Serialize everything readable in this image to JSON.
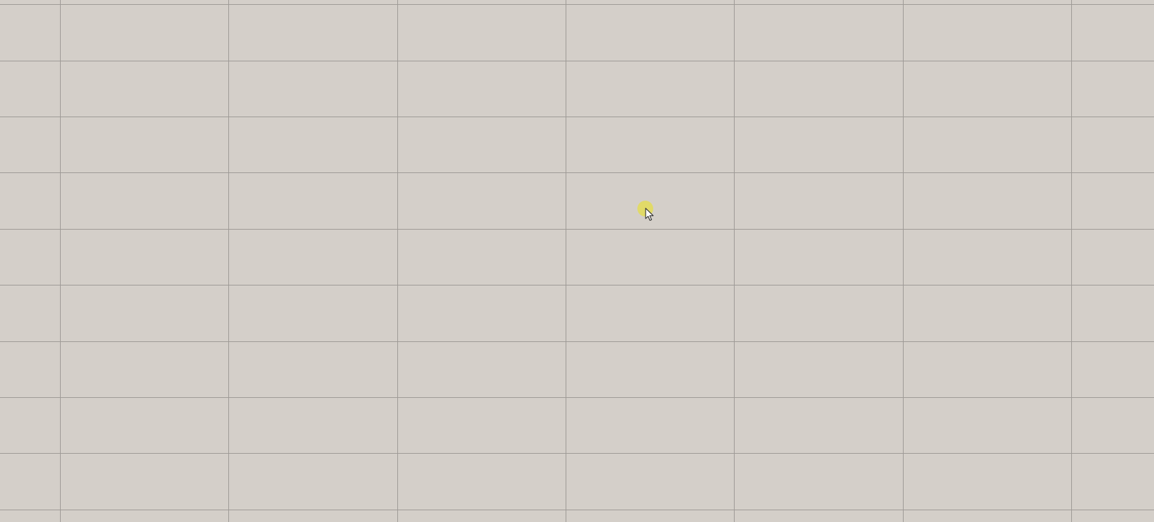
{
  "canvas": {
    "background": "#d4cfc9",
    "grid_line_color": "#9e9a96",
    "columns": 8,
    "rows": 10
  },
  "cursor": {
    "icon": "pointer-arrow-icon",
    "highlight_color": "#e3dc57",
    "arrow_fill": "#ffffff",
    "arrow_stroke": "#2b2b2b"
  }
}
